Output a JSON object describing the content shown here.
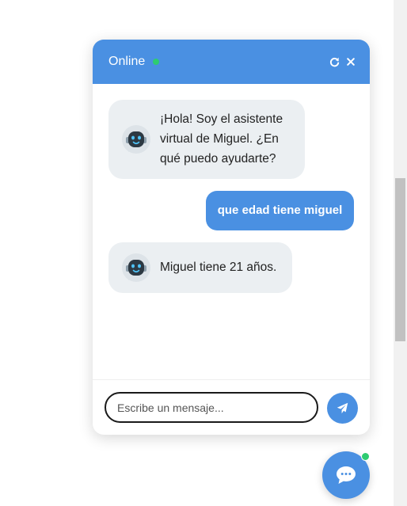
{
  "header": {
    "title": "Online",
    "status_color": "#2ecc71",
    "refresh_icon": "refresh-icon",
    "close_icon": "close-icon"
  },
  "messages": [
    {
      "sender": "bot",
      "text": "¡Hola! Soy el asistente virtual de Miguel. ¿En qué puedo ayudarte?"
    },
    {
      "sender": "user",
      "text": "que edad tiene miguel"
    },
    {
      "sender": "bot",
      "text": "Miguel tiene 21 años."
    }
  ],
  "input": {
    "placeholder": "Escribe un mensaje...",
    "value": ""
  },
  "send_button": {
    "icon": "paper-plane-icon"
  },
  "launcher": {
    "icon": "chat-bubble-icon",
    "status_color": "#2ecc71"
  },
  "colors": {
    "accent": "#4a90e2",
    "bot_bubble": "#ebeff2",
    "online": "#2ecc71"
  }
}
